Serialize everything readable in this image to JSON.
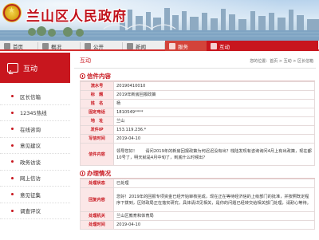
{
  "site": {
    "title": "兰山区人民政府"
  },
  "nav": [
    {
      "label": "首页",
      "icon": "home-icon",
      "active": false
    },
    {
      "label": "概况",
      "icon": "overview-icon",
      "active": false
    },
    {
      "label": "公开",
      "icon": "public-icon",
      "active": false
    },
    {
      "label": "新闻",
      "icon": "news-icon",
      "active": false
    },
    {
      "label": "服务",
      "icon": "service-icon",
      "active": false
    },
    {
      "label": "互动",
      "icon": "interact-icon",
      "active": true
    }
  ],
  "sidebar": {
    "title": "互动",
    "items": [
      {
        "label": "区长信箱"
      },
      {
        "label": "12345热线"
      },
      {
        "label": "在线咨询"
      },
      {
        "label": "意见建议"
      },
      {
        "label": "政务访谈"
      },
      {
        "label": "网上信访"
      },
      {
        "label": "意见征集"
      },
      {
        "label": "调查评议"
      }
    ]
  },
  "main": {
    "title": "互动",
    "breadcrumb": "您的位置：首页 > 互动 > 区长信箱"
  },
  "letter": {
    "section_title": "信件内容",
    "rows": [
      {
        "label": "流水号",
        "value": "20190410010"
      },
      {
        "label": "标　题",
        "value": "2019年新房回报政策"
      },
      {
        "label": "姓　名",
        "value": "杨"
      },
      {
        "label": "固定电话",
        "value": "1810549****"
      },
      {
        "label": "地　址",
        "value": "兰山"
      },
      {
        "label": "发件IP",
        "value": "153.119.236.*"
      },
      {
        "label": "写信时间",
        "value": "2019-04-10"
      },
      {
        "label": "信件内容",
        "value": "领导您好！　　请问2019年的新房回报政策为何迟迟没有出？栈陆发现有咨询询问4月上有出政策，现在都10号了，明天就是4月中旬了，到底什么时候出？"
      }
    ]
  },
  "reply": {
    "section_title": "办理情况",
    "rows": [
      {
        "label": "处理状态",
        "value": "已处理"
      },
      {
        "label": "回复内容",
        "value": "您好！2019年的回报专项资金已经开始审核完成，现在正在等待经济信的上级部门的批准，并按照既定程序下拨到，区财政局正在落实研究，具体请详见相关，是你的问题已经转交给相关部门处理，请耐心等待。"
      },
      {
        "label": "处理机关",
        "value": "兰山区教育和体育局"
      },
      {
        "label": "处理时间",
        "value": "2019-04-10"
      }
    ]
  },
  "colors": {
    "brand_red": "#c8161e",
    "label_bg": "#fbe7e7",
    "nav_bg": "#eeeeee"
  }
}
